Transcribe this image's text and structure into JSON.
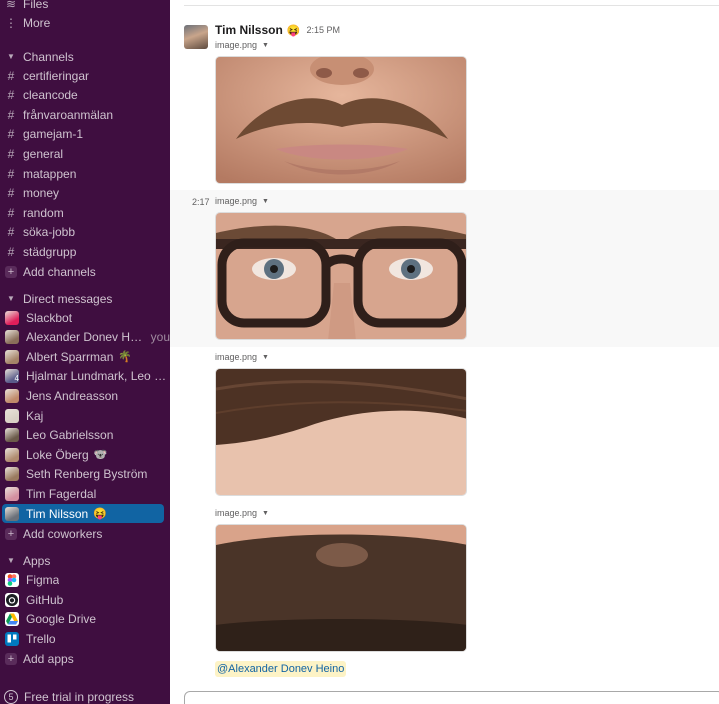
{
  "sidebar": {
    "top_items": [
      {
        "label": "Files",
        "icon": "files-icon"
      },
      {
        "label": "More",
        "icon": "more-icon"
      }
    ],
    "channels_header": "Channels",
    "channels": [
      "certifieringar",
      "cleancode",
      "frånvaroanmälan",
      "gamejam-1",
      "general",
      "matappen",
      "money",
      "random",
      "söka-jobb",
      "städgrupp"
    ],
    "add_channels": "Add channels",
    "dm_header": "Direct messages",
    "dms": [
      {
        "name": "Slackbot",
        "extra": "",
        "color": "#e01e5a"
      },
      {
        "name": "Alexander Donev Heino",
        "extra": "you",
        "color": "#8a6f5a"
      },
      {
        "name": "Albert Sparrman",
        "extra": "🌴",
        "color": "#a58468"
      },
      {
        "name": "Hjalmar Lundmark, Leo Gab...",
        "extra": "",
        "color": "#5a5b8a",
        "badge": "4"
      },
      {
        "name": "Jens Andreasson",
        "extra": "",
        "color": "#c08a6a"
      },
      {
        "name": "Kaj",
        "extra": "",
        "color": "#d9d0c5"
      },
      {
        "name": "Leo Gabrielsson",
        "extra": "",
        "color": "#6b5a4a"
      },
      {
        "name": "Loke Öberg",
        "extra": "🐨",
        "color": "#b08b6f"
      },
      {
        "name": "Seth Renberg Byström",
        "extra": "",
        "color": "#9a7a5f"
      },
      {
        "name": "Tim Fagerdal",
        "extra": "",
        "color": "#d48fa0"
      },
      {
        "name": "Tim Nilsson",
        "extra": "😝",
        "color": "#6b7079",
        "active": true
      }
    ],
    "add_coworkers": "Add coworkers",
    "apps_header": "Apps",
    "apps": [
      {
        "name": "Figma",
        "icon": "figma-icon"
      },
      {
        "name": "GitHub",
        "icon": "github-icon"
      },
      {
        "name": "Google Drive",
        "icon": "google-drive-icon"
      },
      {
        "name": "Trello",
        "icon": "trello-icon"
      }
    ],
    "add_apps": "Add apps",
    "trial": "Free trial in progress",
    "trial_badge": "5"
  },
  "message": {
    "sender": "Tim Nilsson",
    "sender_emoji": "😝",
    "time": "2:15 PM",
    "second_time": "2:17",
    "files": [
      "image.png",
      "image.png",
      "image.png",
      "image.png"
    ],
    "mention": "@Alexander Donev Heino"
  }
}
